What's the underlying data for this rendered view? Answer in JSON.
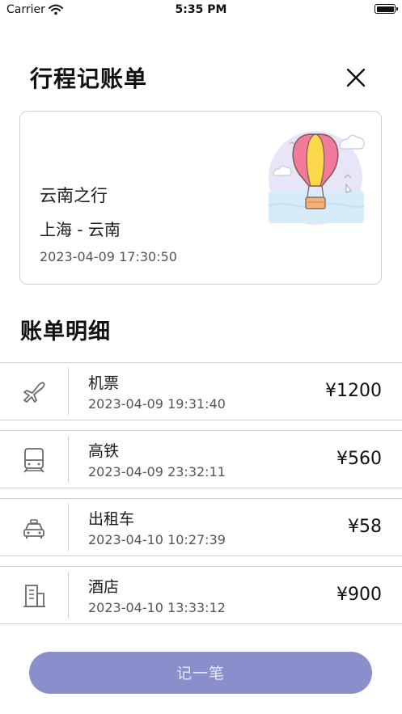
{
  "status_bar": {
    "carrier": "Carrier",
    "time": "5:35 PM"
  },
  "header": {
    "title": "行程记账单",
    "close_icon": "close-icon"
  },
  "trip": {
    "name": "云南之行",
    "route": "上海 - 云南",
    "time": "2023-04-09 17:30:50",
    "illustration": "hot-air-balloon"
  },
  "bills": {
    "section_title": "账单明细",
    "items": [
      {
        "icon": "airplane-icon",
        "label": "机票",
        "time": "2023-04-09 19:31:40",
        "amount": "¥1200"
      },
      {
        "icon": "train-icon",
        "label": "高铁",
        "time": "2023-04-09 23:32:11",
        "amount": "¥560"
      },
      {
        "icon": "taxi-icon",
        "label": "出租车",
        "time": "2023-04-10 10:27:39",
        "amount": "¥58"
      },
      {
        "icon": "hotel-icon",
        "label": "酒店",
        "time": "2023-04-10 13:33:12",
        "amount": "¥900"
      }
    ]
  },
  "actions": {
    "add_label": "记一笔"
  },
  "colors": {
    "accent": "#8a8fcb",
    "divider": "#cfcfd4",
    "icon_gray": "#6b6b6b"
  }
}
